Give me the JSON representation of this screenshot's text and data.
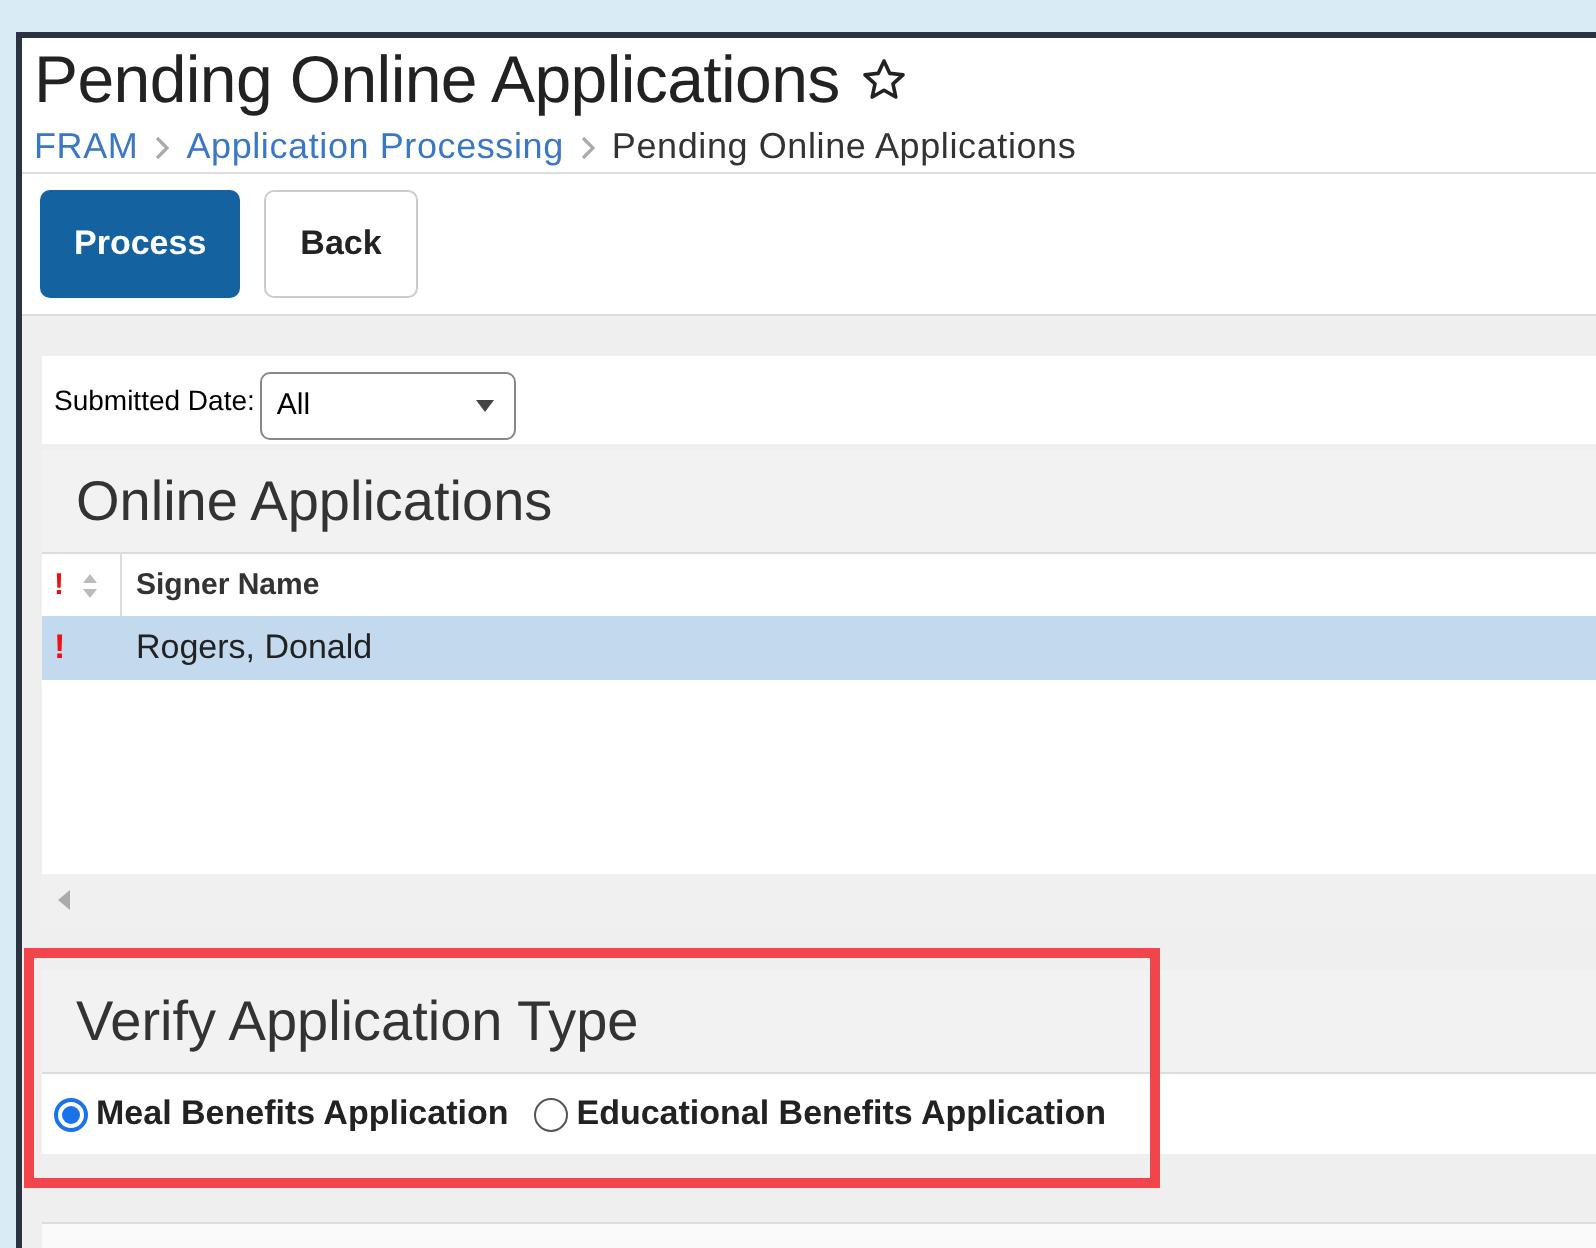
{
  "page": {
    "title": "Pending Online Applications",
    "favorite": false
  },
  "breadcrumb": [
    {
      "label": "FRAM",
      "link": true
    },
    {
      "label": "Application Processing",
      "link": true
    },
    {
      "label": "Pending Online Applications",
      "link": false
    }
  ],
  "toolbar": [
    {
      "label": "Process",
      "kind": "primary"
    },
    {
      "label": "Back",
      "kind": "secondary"
    }
  ],
  "filter": {
    "label": "Submitted Date:",
    "value": "All"
  },
  "online_applications": {
    "title": "Online Applications",
    "columns": [
      {
        "label": "!",
        "sortable": true
      },
      {
        "label": "Signer Name",
        "sortable": false
      }
    ],
    "rows": [
      {
        "flag": "!",
        "signer_name": "Rogers, Donald",
        "selected": true
      }
    ]
  },
  "verify_application_type": {
    "title": "Verify Application Type",
    "highlighted": true,
    "options": [
      {
        "label": "Meal Benefits Application",
        "selected": true
      },
      {
        "label": "Educational Benefits Application",
        "selected": false
      }
    ]
  }
}
